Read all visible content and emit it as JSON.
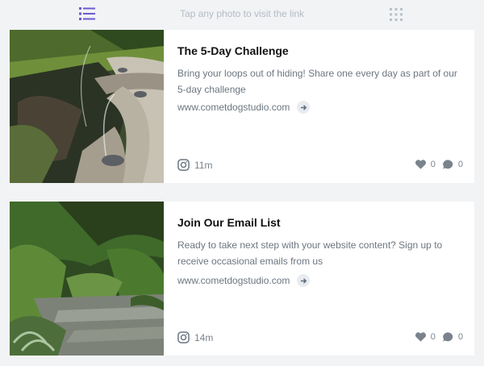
{
  "header": {
    "hint_text": "Tap any photo to visit the link",
    "left_icon": "list-view-icon",
    "right_icon": "grid-view-icon",
    "accent_color": "#6a5bd0"
  },
  "cards": [
    {
      "title": "The 5-Day Challenge",
      "description": "Bring your loops out of hiding! Share one every day as part of our 5-day challenge",
      "link": "www.cometdogstudio.com",
      "time": "11m",
      "likes": "0",
      "comments": "0",
      "photo_icon": "fountain-photo"
    },
    {
      "title": "Join Our Email List",
      "description": "Ready to take next step with your website content? Sign up to receive occasional emails from us",
      "link": "www.cometdogstudio.com",
      "time": "14m",
      "likes": "0",
      "comments": "0",
      "photo_icon": "garden-path-photo"
    }
  ]
}
